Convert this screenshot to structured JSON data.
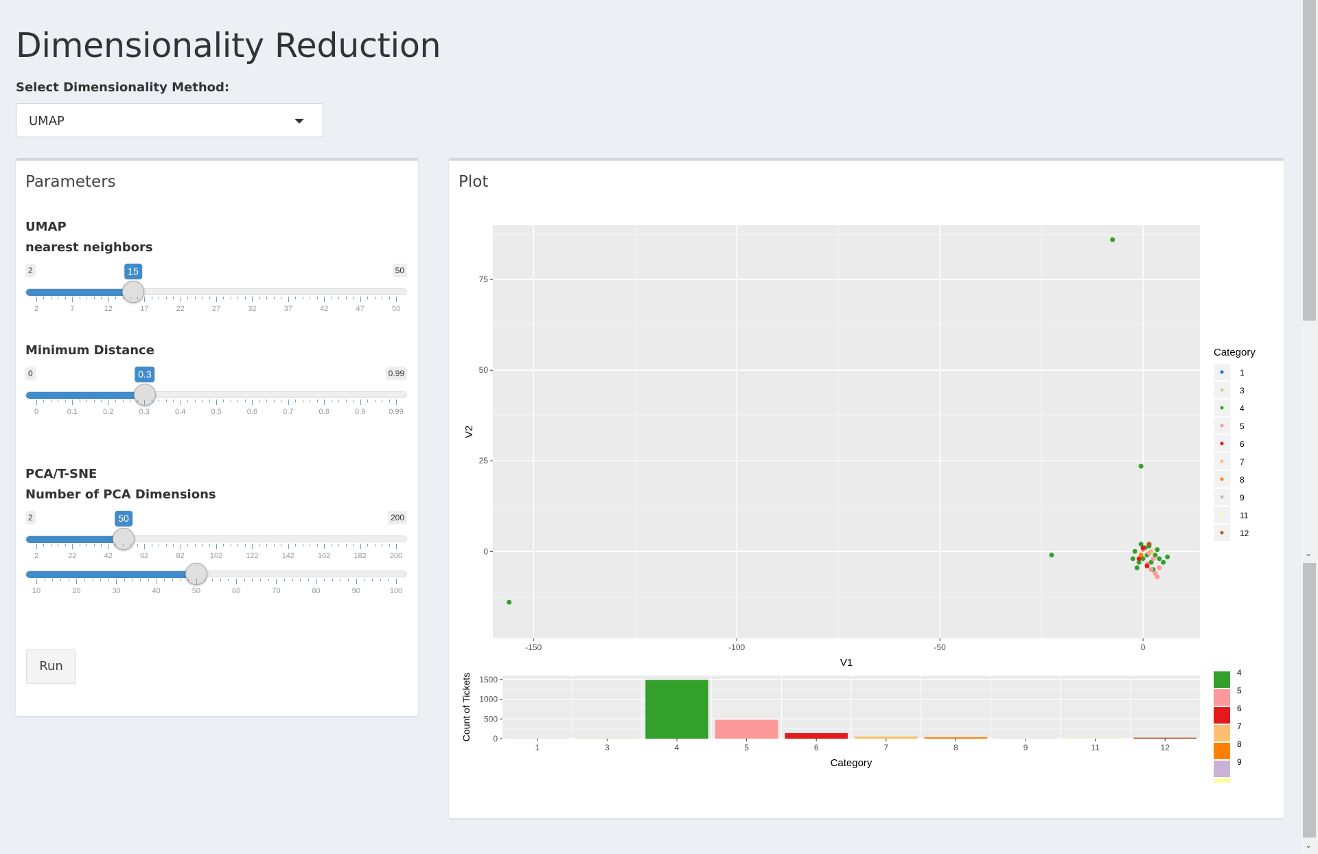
{
  "page": {
    "title": "Dimensionality Reduction"
  },
  "method_select": {
    "label": "Select Dimensionality Method:",
    "value": "UMAP"
  },
  "parameters": {
    "title": "Parameters",
    "umap_heading": "UMAP",
    "nearest_neighbors": {
      "label": "nearest neighbors",
      "min": "2",
      "max": "50",
      "value": "15",
      "ticks": [
        "2",
        "7",
        "12",
        "17",
        "22",
        "27",
        "32",
        "37",
        "42",
        "47",
        "50"
      ]
    },
    "min_distance": {
      "label": "Minimum Distance",
      "min": "0",
      "max": "0.99",
      "value": "0.3",
      "ticks": [
        "0",
        "0.1",
        "0.2",
        "0.3",
        "0.4",
        "0.5",
        "0.6",
        "0.7",
        "0.8",
        "0.9",
        "0.99"
      ]
    },
    "pca_heading": "PCA/T-SNE",
    "pca_dims": {
      "label": "Number of PCA Dimensions",
      "min": "2",
      "max": "200",
      "value": "50",
      "ticks": [
        "2",
        "22",
        "42",
        "62",
        "82",
        "102",
        "122",
        "142",
        "162",
        "182",
        "200"
      ]
    },
    "perplexity": {
      "ticks": [
        "10",
        "20",
        "30",
        "40",
        "50",
        "60",
        "70",
        "80",
        "90",
        "100"
      ],
      "value": 50,
      "min": 10,
      "max": 100
    },
    "run_label": "Run"
  },
  "plot": {
    "title": "Plot"
  },
  "colors": {
    "accent": "#428bca",
    "cat_1": "#1f78b4",
    "cat_3": "#b2df8a",
    "cat_4": "#33a02c",
    "cat_5": "#fb9a99",
    "cat_6": "#e31a1c",
    "cat_7": "#fdbf6f",
    "cat_8": "#ff7f00",
    "cat_9": "#cab2d6",
    "cat_11": "#ffff99",
    "cat_12": "#b15928"
  },
  "chart_data": [
    {
      "type": "scatter",
      "xlabel": "V1",
      "ylabel": "V2",
      "xlim": [
        -160,
        14
      ],
      "ylim": [
        -24,
        90
      ],
      "x_ticks": [
        "-150",
        "-100",
        "-50",
        "0"
      ],
      "y_ticks": [
        "0",
        "25",
        "50",
        "75"
      ],
      "legend_title": "Category",
      "legend": [
        "1",
        "3",
        "4",
        "5",
        "6",
        "7",
        "8",
        "9",
        "11",
        "12"
      ],
      "legend_position": "right",
      "grid": true,
      "points": [
        {
          "x": -7.5,
          "y": 86,
          "cat": "4"
        },
        {
          "x": -156,
          "y": -14,
          "cat": "4"
        },
        {
          "x": -22.5,
          "y": -1,
          "cat": "4"
        },
        {
          "x": -0.5,
          "y": 23.5,
          "cat": "4"
        },
        {
          "x": 0,
          "y": -2,
          "cat": "4"
        },
        {
          "x": 1,
          "y": -1,
          "cat": "4"
        },
        {
          "x": -1,
          "y": -3,
          "cat": "4"
        },
        {
          "x": 2,
          "y": -3,
          "cat": "4"
        },
        {
          "x": 3,
          "y": -1,
          "cat": "4"
        },
        {
          "x": -2,
          "y": 0,
          "cat": "4"
        },
        {
          "x": 0.5,
          "y": 1,
          "cat": "4"
        },
        {
          "x": 4,
          "y": -2,
          "cat": "4"
        },
        {
          "x": -1.5,
          "y": -4.5,
          "cat": "4"
        },
        {
          "x": 1.5,
          "y": 1.5,
          "cat": "4"
        },
        {
          "x": 5,
          "y": -3,
          "cat": "4"
        },
        {
          "x": 2.5,
          "y": -5,
          "cat": "4"
        },
        {
          "x": -0.5,
          "y": 2,
          "cat": "4"
        },
        {
          "x": 3.5,
          "y": 0.5,
          "cat": "4"
        },
        {
          "x": 6,
          "y": -1.5,
          "cat": "4"
        },
        {
          "x": -2.5,
          "y": -2,
          "cat": "4"
        },
        {
          "x": 3,
          "y": -6,
          "cat": "5"
        },
        {
          "x": 2,
          "y": -5,
          "cat": "5"
        },
        {
          "x": 4,
          "y": -4.5,
          "cat": "5"
        },
        {
          "x": 1,
          "y": -3.5,
          "cat": "5"
        },
        {
          "x": 3.5,
          "y": -7,
          "cat": "5"
        },
        {
          "x": 2.5,
          "y": -2,
          "cat": "5"
        },
        {
          "x": 0,
          "y": 0.5,
          "cat": "5"
        },
        {
          "x": 1.5,
          "y": -0.5,
          "cat": "5"
        },
        {
          "x": -1,
          "y": -2,
          "cat": "6"
        },
        {
          "x": 1,
          "y": -4,
          "cat": "6"
        },
        {
          "x": 0,
          "y": 1,
          "cat": "6"
        },
        {
          "x": 2,
          "y": 0,
          "cat": "7"
        },
        {
          "x": -0.5,
          "y": -1,
          "cat": "8"
        },
        {
          "x": 1.5,
          "y": 2,
          "cat": "12"
        }
      ]
    },
    {
      "type": "bar",
      "xlabel": "Category",
      "ylabel": "Count of Tickets",
      "ylim": [
        0,
        1600
      ],
      "y_ticks": [
        "0",
        "500",
        "1000",
        "1500"
      ],
      "categories": [
        "1",
        "3",
        "4",
        "5",
        "6",
        "7",
        "8",
        "9",
        "11",
        "12"
      ],
      "values": [
        2,
        6,
        1490,
        480,
        140,
        55,
        35,
        5,
        8,
        25
      ],
      "legend": [
        "4",
        "5",
        "6",
        "7",
        "8",
        "9"
      ],
      "grid": true
    }
  ]
}
